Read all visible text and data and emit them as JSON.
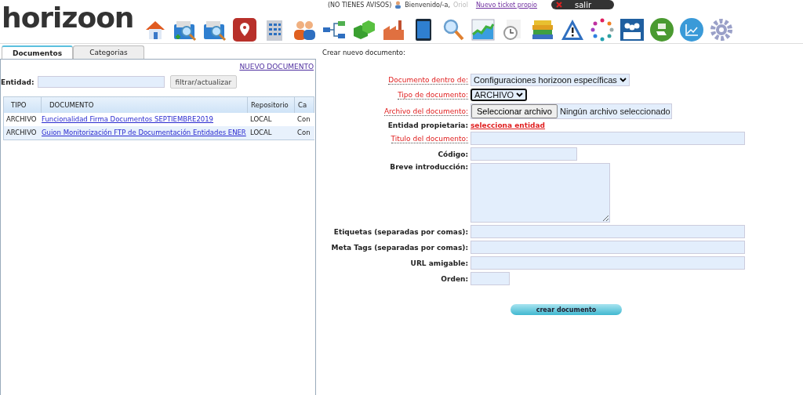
{
  "logo": "horizoon",
  "top_bar": {
    "notices": "(NO TIENES AVISOS)",
    "welcome": "Bienvenido/-a,",
    "user": "Oriol",
    "ticket_link": "Nuevo ticket propio",
    "logout": "salir"
  },
  "tabs": [
    {
      "label": "Documentos",
      "selected": true
    },
    {
      "label": "Categorias",
      "selected": false
    }
  ],
  "new_document_link": "NUEVO DOCUMENTO",
  "filter": {
    "label": "Entidad:",
    "button": "filtrar/actualizar"
  },
  "table": {
    "columns": [
      "TIPO",
      "DOCUMENTO",
      "Repositorio",
      "Ca"
    ],
    "rows": [
      {
        "cells": [
          "ARCHIVO",
          "Funcionalidad Firma Documentos SEPTIEMBRE2019",
          "LOCAL",
          "Con"
        ],
        "selected": false
      },
      {
        "cells": [
          "ARCHIVO",
          "Guion Monitorización FTP de Documentación Entidades ENER",
          "LOCAL",
          "Con"
        ],
        "selected": true
      }
    ]
  },
  "form": {
    "title": "Crear nuevo documento:",
    "fields": [
      {
        "label": "Documento dentro de:",
        "required": true,
        "kind": "select",
        "value": "Configuraciones horizoon específicas"
      },
      {
        "label": "Tipo de documento:",
        "required": true,
        "kind": "select",
        "value": "ARCHIVO"
      },
      {
        "label": "Archivo del documento:",
        "required": true,
        "kind": "file",
        "button": "Seleccionar archivo",
        "value": "Ningún archivo seleccionado"
      },
      {
        "label": "Entidad propietaria:",
        "required": false,
        "kind": "link",
        "value": "selecciona entidad"
      },
      {
        "label": "Titulo del documento:",
        "required": true,
        "kind": "wide"
      },
      {
        "label": "Código:",
        "required": false,
        "kind": "short"
      },
      {
        "label": "Breve introducción:",
        "required": false,
        "kind": "textarea"
      },
      {
        "label": "Etiquetas (separadas por comas):",
        "required": false,
        "kind": "wide"
      },
      {
        "label": "Meta Tags (separadas por comas):",
        "required": false,
        "kind": "wide"
      },
      {
        "label": "URL amigable:",
        "required": false,
        "kind": "wide"
      },
      {
        "label": "Orden:",
        "required": false,
        "kind": "tiny"
      }
    ],
    "submit": "crear documento"
  }
}
